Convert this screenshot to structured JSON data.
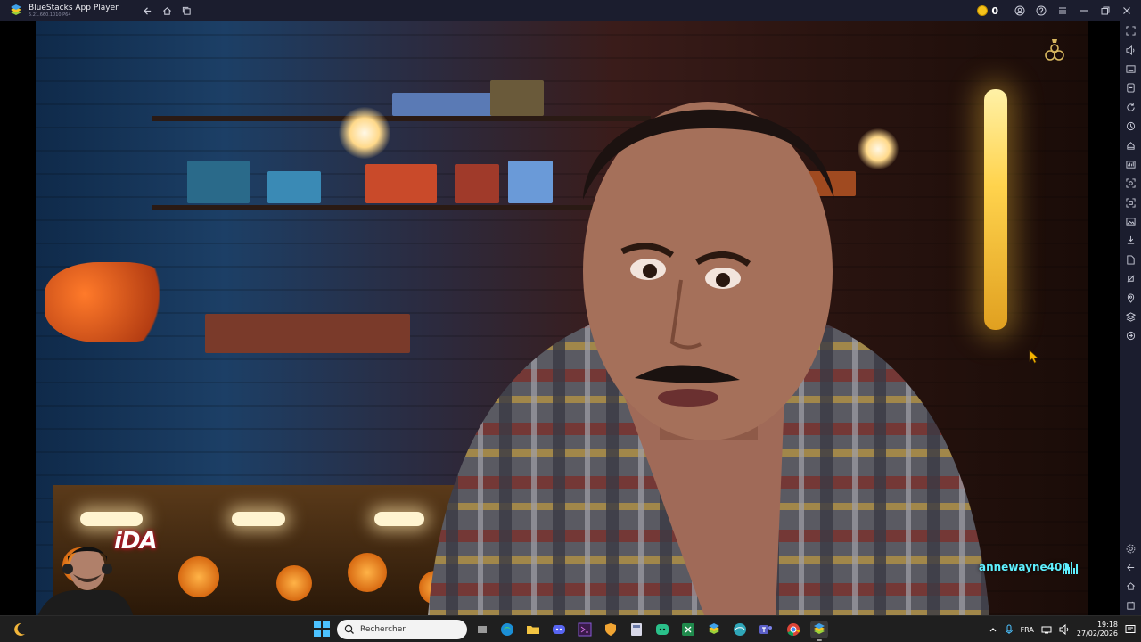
{
  "window": {
    "title": "BlueStacks App Player",
    "version": "5.21.660.1010 P64",
    "coins": "0"
  },
  "video": {
    "username_overlay": "annewayne400",
    "brand_overlay": "iDA"
  },
  "taskbar": {
    "search_placeholder": "Rechercher",
    "language": "FRA",
    "time": "19:18",
    "date": "27/02/2026"
  },
  "colors": {
    "titlebar_bg": "#1b1d2e",
    "taskbar_bg": "#1f1f1f",
    "username_color": "#5ef0ff",
    "coin_color": "#f4c21b"
  },
  "icons": {
    "titlebar": [
      "back-icon",
      "home-icon",
      "multi-instance-icon",
      "coin-icon",
      "account-icon",
      "help-icon",
      "menu-icon",
      "minimize-icon",
      "restore-icon",
      "close-icon"
    ],
    "rightbar": [
      "fullscreen-icon",
      "volume-icon",
      "keyboard-icon",
      "gamepad-icon",
      "rotate-icon",
      "sync-icon",
      "macro-icon",
      "performance-icon",
      "screenshot-icon",
      "record-icon",
      "media-folder-icon",
      "install-apk-icon",
      "files-icon",
      "eco-mode-icon",
      "location-icon",
      "layers-icon",
      "refresh-icon"
    ],
    "rightbar_bottom": [
      "settings-icon",
      "back-arrow-icon",
      "home-icon",
      "recent-apps-icon"
    ]
  }
}
